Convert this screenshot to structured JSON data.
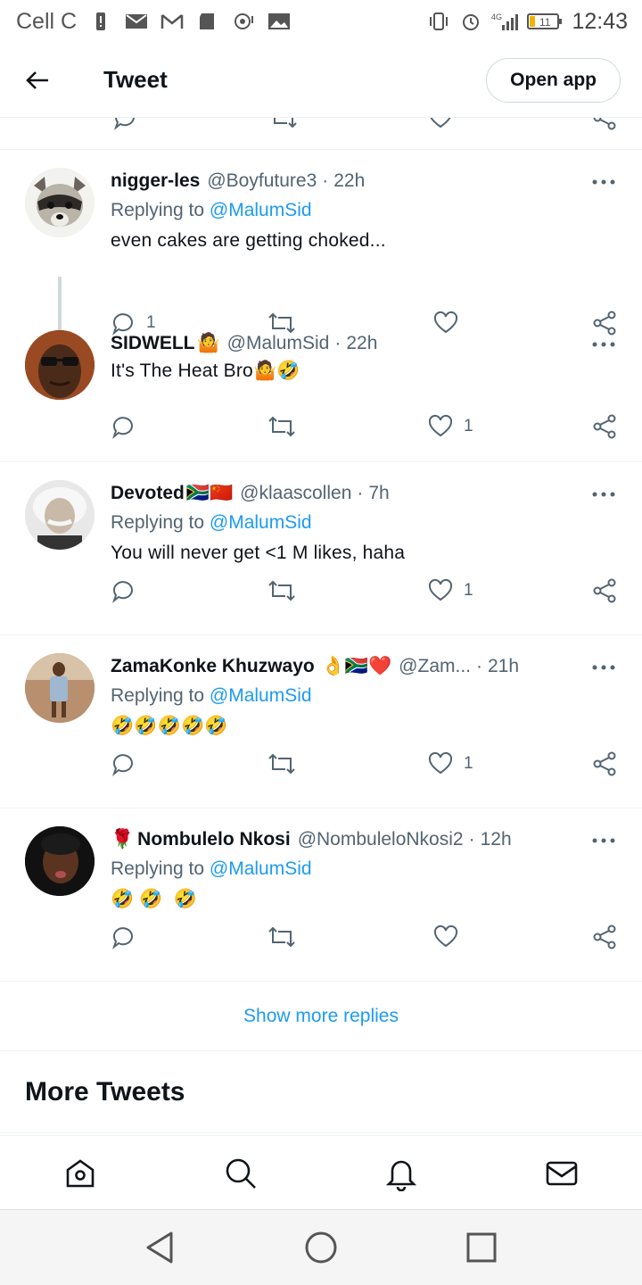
{
  "status_bar": {
    "carrier": "Cell C",
    "network": "4G",
    "battery": "11",
    "time": "12:43"
  },
  "top_bar": {
    "title": "Tweet",
    "open_app_label": "Open app"
  },
  "tweets": [
    {
      "name": "nigger-les",
      "handle": "@Boyfuture3",
      "time": "22h",
      "replying_prefix": "Replying to ",
      "replying_to": "@MalumSid",
      "text": "even cakes are getting choked...",
      "reply_count": "1",
      "retweet_count": "",
      "like_count": ""
    },
    {
      "name": "SIDWELL",
      "name_emoji": "🤷",
      "handle": "@MalumSid",
      "time": "22h",
      "text": "It's The Heat Bro",
      "text_emoji": "🤷🤣",
      "reply_count": "",
      "retweet_count": "",
      "like_count": "1"
    },
    {
      "name": "Devoted",
      "name_emoji": "🇿🇦🇨🇳",
      "handle": "@klaascollen",
      "time": "7h",
      "replying_prefix": "Replying to ",
      "replying_to": "@MalumSid",
      "text": "You will never get <1 M likes, haha",
      "reply_count": "",
      "retweet_count": "",
      "like_count": "1"
    },
    {
      "name": "ZamaKonke Khuzwayo",
      "name_emoji": "👌🇿🇦❤️",
      "handle": "@Zam...",
      "time": "21h",
      "replying_prefix": "Replying to ",
      "replying_to": "@MalumSid",
      "text": "🤣🤣🤣🤣🤣",
      "reply_count": "",
      "retweet_count": "",
      "like_count": "1"
    },
    {
      "name_prefix_emoji": "🌹",
      "name": "Nombulelo Nkosi",
      "handle": "@NombuleloNkosi2",
      "time": "12h",
      "replying_prefix": "Replying to ",
      "replying_to": "@MalumSid",
      "text": "🤣 🤣  🤣",
      "reply_count": "",
      "retweet_count": "",
      "like_count": ""
    }
  ],
  "show_more_replies": "Show more replies",
  "more_tweets": "More Tweets",
  "colors": {
    "accent": "#1d9bf0",
    "text": "#0f1419",
    "muted": "#536471",
    "divider": "#eff3f4"
  },
  "icons": {
    "back": "arrow-left-icon",
    "reply": "reply-icon",
    "retweet": "retweet-icon",
    "like": "heart-icon",
    "share": "share-icon",
    "more": "more-icon",
    "nav": [
      "home-icon",
      "search-icon",
      "bell-icon",
      "mail-icon"
    ],
    "system": [
      "back-triangle-icon",
      "home-circle-icon",
      "recents-square-icon"
    ]
  }
}
